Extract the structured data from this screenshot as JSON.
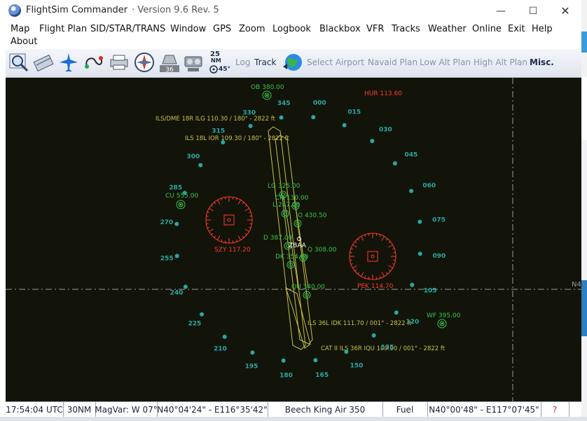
{
  "window": {
    "app_name": "FlightSim Commander",
    "version": "· Version 9.6 Rev. 5"
  },
  "menu": [
    "Map",
    "Flight Plan",
    "SID/STAR/TRANS",
    "Window",
    "GPS",
    "Zoom",
    "Logbook",
    "Blackbox",
    "VFR",
    "Tracks",
    "Weather",
    "Online",
    "Exit",
    "Help",
    "About"
  ],
  "toolbar": {
    "wind_speed": "25",
    "wind_unit": "NM",
    "heading_badge": "36",
    "angle": "45°",
    "log": "Log",
    "track": "Track",
    "select_airport": "Select Airport",
    "navaid_plan": "Navaid Plan",
    "low_alt_plan": "Low Alt Plan",
    "high_alt_plan": "High Alt Plan",
    "misc": "Misc."
  },
  "map": {
    "airport": "ZBAA",
    "vor": [
      {
        "label": "HUR 113.60"
      },
      {
        "label": "SZY 117.20"
      },
      {
        "label": "PEK 114.70"
      }
    ],
    "ndb": [
      {
        "label": "OB 380.00"
      },
      {
        "label": "CU 555.00"
      },
      {
        "label": "WF 395.00"
      },
      {
        "label": "LG 325.00"
      },
      {
        "label": "CH 130.00"
      },
      {
        "label": "L 247.00"
      },
      {
        "label": "O 430.50"
      },
      {
        "label": "D 387.00"
      },
      {
        "label": "Q 308.00"
      },
      {
        "label": "DK 354.00"
      },
      {
        "label": "OU 340.00"
      }
    ],
    "ils": [
      {
        "label": "ILS/DME 18R  ILG 110.30 / 180° - 2822 ft"
      },
      {
        "label": "ILS 18L  IOR 109.30 / 180° - 2822 ft"
      },
      {
        "label": "ILS 36L  IDK 111.70 / 001° - 2822 ft"
      },
      {
        "label": "CAT II ILS 36R  IQU 109.90 / 001° - 2822 ft"
      }
    ],
    "bearings": [
      "000",
      "015",
      "030",
      "045",
      "060",
      "075",
      "090",
      "105",
      "120",
      "135",
      "150",
      "165",
      "180",
      "195",
      "210",
      "225",
      "240",
      "255",
      "270",
      "285",
      "300",
      "315",
      "330",
      "345"
    ],
    "grid_label": "N4"
  },
  "status": {
    "time": "17:54:04 UTC",
    "range": "30NM",
    "magvar": "MagVar: W 07°",
    "position": "N40°04'24\" - E116°35'42\"",
    "aircraft": "Beech King Air 350",
    "fuel": "Fuel",
    "cursor": "N40°00'48\" - E117°07'45\"",
    "help": "?"
  },
  "colors": {
    "map_bg": "#121409",
    "bearing": "#2aa6a6",
    "navaid_green": "#3cc24b",
    "vor_red": "#ff3a2a",
    "ils_yellow": "#c9c24a"
  }
}
